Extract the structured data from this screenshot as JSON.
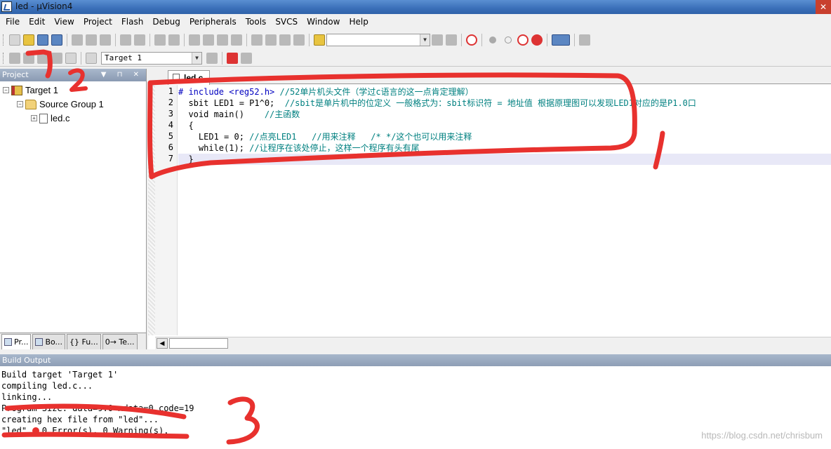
{
  "window": {
    "title": "led  - µVision4"
  },
  "menu": [
    "File",
    "Edit",
    "View",
    "Project",
    "Flash",
    "Debug",
    "Peripherals",
    "Tools",
    "SVCS",
    "Window",
    "Help"
  ],
  "toolbar2": {
    "target_select": "Target 1"
  },
  "project": {
    "header": "Project",
    "tree": {
      "target": "Target 1",
      "group": "Source Group 1",
      "file": "led.c"
    },
    "tabs": [
      "Pr...",
      "Bo...",
      "{} Fu...",
      "0→ Te..."
    ]
  },
  "editor": {
    "tab": "led.c",
    "line_numbers": [
      "1",
      "2",
      "3",
      "4",
      "5",
      "6",
      "7"
    ],
    "lines": [
      {
        "code": "# include <reg52.h> ",
        "comment": "//52单片机头文件（学过c语言的这一点肯定理解）"
      },
      {
        "code": "  sbit LED1 = P1^0;  ",
        "comment": "//sbit是单片机中的位定义 一般格式为：sbit标识符 = 地址值 根据原理图可以发现LED1对应的是P1.0口"
      },
      {
        "code": "  void main()    ",
        "comment": "//主函数"
      },
      {
        "code": "  {",
        "comment": ""
      },
      {
        "code": "    LED1 = 0; ",
        "comment": "//点亮LED1   //用来注释   /* */这个也可以用来注释"
      },
      {
        "code": "    while(1); ",
        "comment": "//让程序在该处停止，这样一个程序有头有尾"
      },
      {
        "code": "  }",
        "comment": ""
      }
    ]
  },
  "build_output": {
    "header": "Build Output",
    "lines": [
      "Build target 'Target 1'",
      "compiling led.c...",
      "linking...",
      "Program Size: data=9.0 xdata=0 code=19",
      "creating hex file from \"led\"...",
      "\"led\" - 0 Error(s), 0 Warning(s)."
    ]
  },
  "watermark": "https://blog.csdn.net/chrisbum",
  "annotations": [
    "1",
    "2",
    "3"
  ]
}
